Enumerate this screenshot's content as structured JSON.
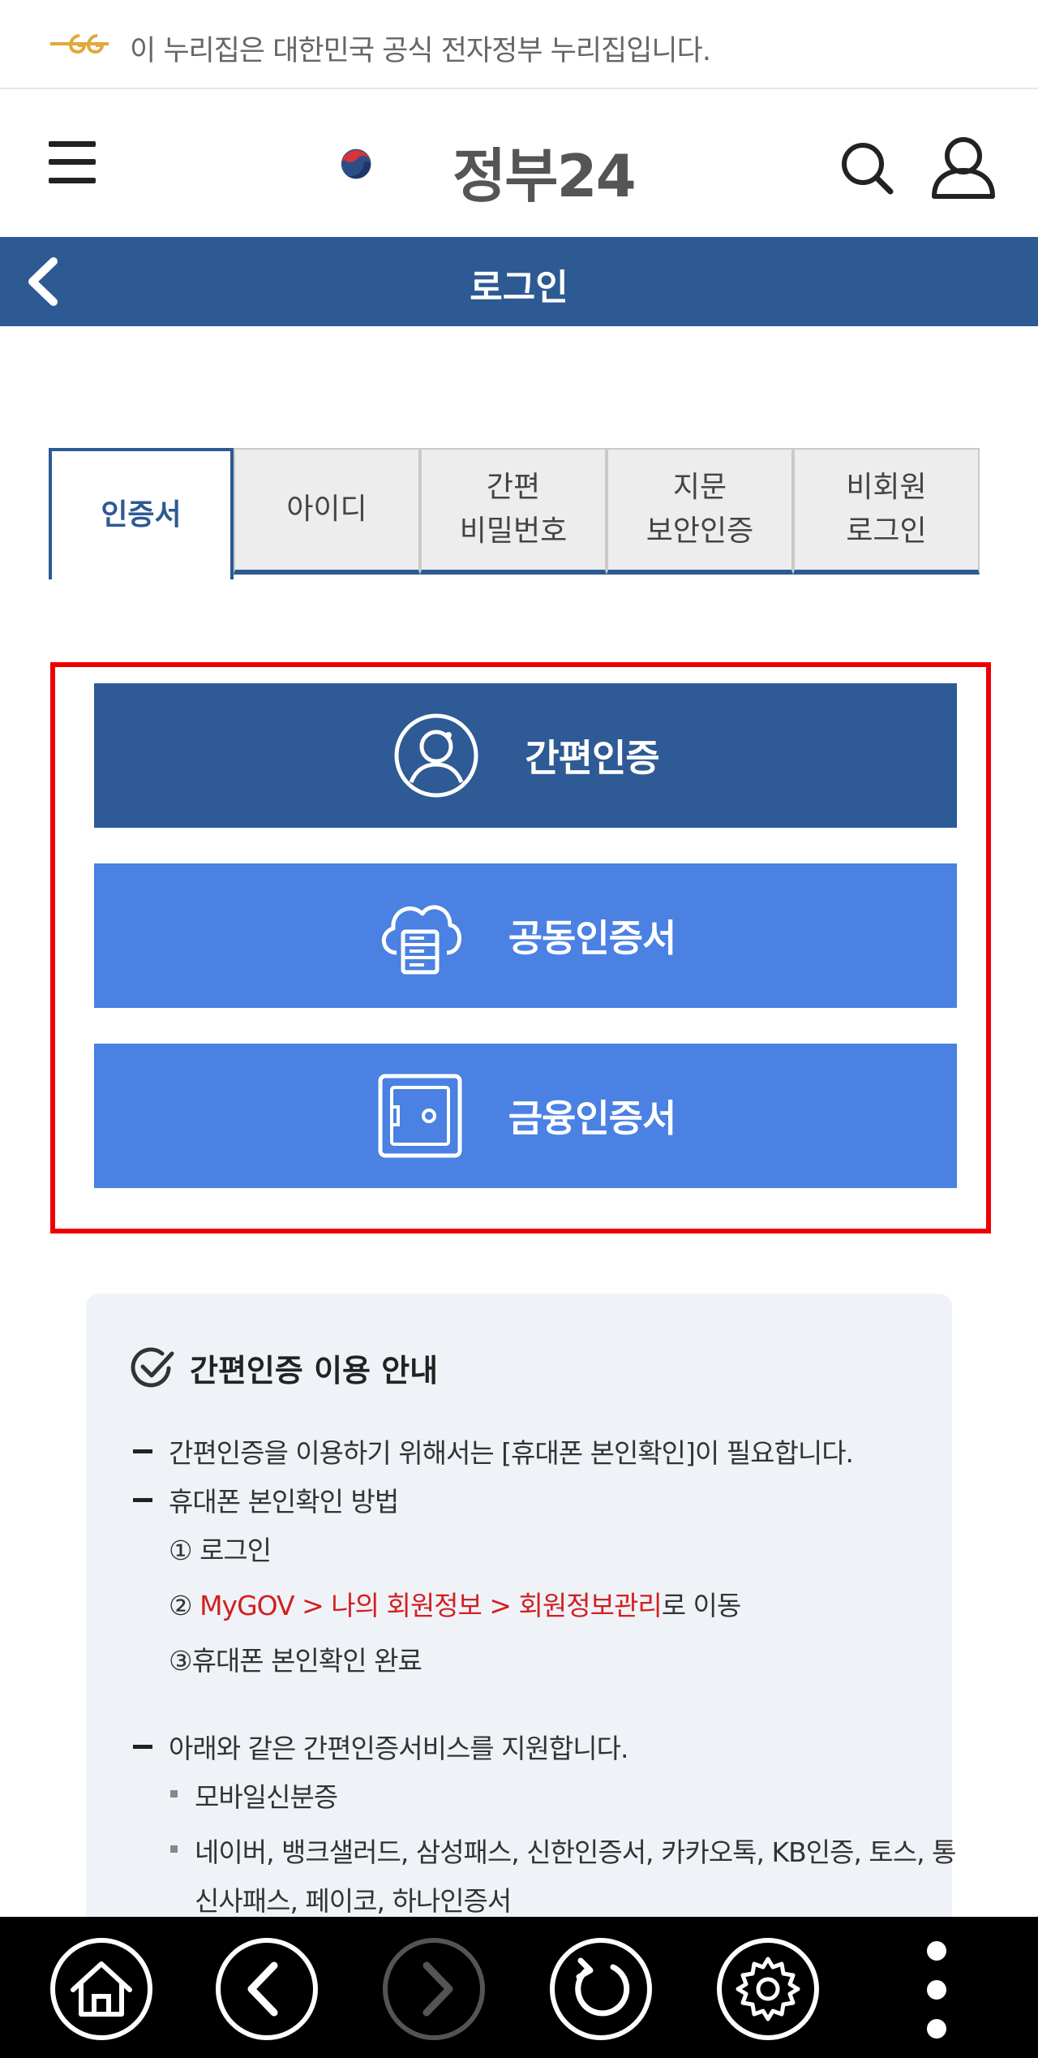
{
  "notice": {
    "text": "이 누리집은 대한민국 공식 전자정부 누리집입니다."
  },
  "header": {
    "logo_text": "정부24"
  },
  "titlebar": {
    "title": "로그인"
  },
  "tabs": [
    {
      "line1": "인증서",
      "line2": ""
    },
    {
      "line1": "아이디",
      "line2": ""
    },
    {
      "line1": "간편",
      "line2": "비밀번호"
    },
    {
      "line1": "지문",
      "line2": "보안인증"
    },
    {
      "line1": "비회원",
      "line2": "로그인"
    }
  ],
  "options": [
    {
      "label": "간편인증"
    },
    {
      "label": "공동인증서"
    },
    {
      "label": "금융인증서"
    }
  ],
  "info": {
    "title": "간편인증 이용 안내",
    "line1": "간편인증을 이용하기 위해서는 [휴대폰 본인확인]이 필요합니다.",
    "line2": "휴대폰 본인확인 방법",
    "step1": "① 로그인",
    "step2_prefix": "② ",
    "step2_red": "MyGOV > 나의 회원정보 > 회원정보관리",
    "step2_suffix": "로 이동",
    "step3": "③휴대폰 본인확인 완료",
    "line3": "아래와 같은 간편인증서비스를 지원합니다.",
    "bullet1": "모바일신분증",
    "bullet2a": "네이버, 뱅크샐러드, 삼성패스, 신한인증서, 카카오톡, KB인증, 토스, 통",
    "bullet2b": "신사패스, 페이코, 하나인증서"
  },
  "colors": {
    "primary": "#2d5a93",
    "accent": "#4a81e2",
    "highlight": "#ee0000",
    "link_red": "#d21f1f"
  }
}
